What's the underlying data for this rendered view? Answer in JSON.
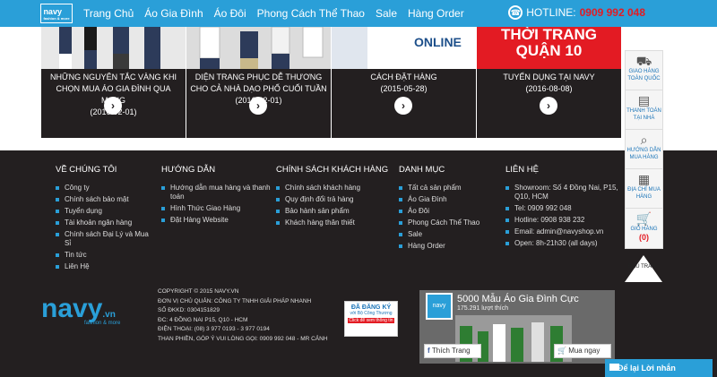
{
  "nav": {
    "logo_text": "navy",
    "logo_sub": "fashion & more",
    "menu": [
      "Trang Chủ",
      "Áo Gia Đình",
      "Áo Đôi",
      "Phong Cách Thể Thao",
      "Sale",
      "Hàng Order"
    ],
    "hotline_label": "HOTLINE:",
    "hotline_number": "0909 992 048"
  },
  "news": [
    {
      "title": "NHỮNG NGUYÊN TẮC VÀNG KHI CHỌN MUA ÁO GIA ĐÌNH QUA MẠNG",
      "date": "(2016-02-01)",
      "banner": ""
    },
    {
      "title": "DIỆN TRANG PHỤC DỄ THƯƠNG CHO CẢ NHÀ DẠO PHỐ CUỐI TUẦN",
      "date": "(2016-02-01)",
      "banner": ""
    },
    {
      "title": "CÁCH ĐẶT HÀNG",
      "date": "(2015-05-28)",
      "banner": "ONLINE"
    },
    {
      "title": "TUYỂN DỤNG TẠI NAVY",
      "date": "(2016-08-08)",
      "banner": "THỜI TRANG QUẬN 10"
    }
  ],
  "side": [
    {
      "label": "GIAO HÀNG TOÀN QUỐC",
      "icon": "truck-icon"
    },
    {
      "label": "THANH TOÁN TẠI NHÀ",
      "icon": "wallet-icon"
    },
    {
      "label": "HƯỚNG DẪN MUA HÀNG",
      "icon": "magnifier-icon"
    },
    {
      "label": "ĐỊA CHỈ MUA HÀNG",
      "icon": "store-icon"
    },
    {
      "label": "GIỎ HÀNG",
      "count": "(0)",
      "icon": "cart-icon"
    }
  ],
  "up_label": "ĐẦU TRANG",
  "footer": {
    "col1": {
      "head": "VỀ CHÚNG TÔI",
      "items": [
        "Công ty",
        "Chính sách bảo mật",
        "Tuyển dụng",
        "Tài khoản ngân hàng",
        "Chính sách Đại Lý và Mua Sỉ",
        "Tin tức",
        "Liên Hệ"
      ]
    },
    "col2": {
      "head": "HƯỚNG DẪN",
      "items": [
        "Hướng dẫn mua hàng và thanh toán",
        "Hình Thức Giao Hàng",
        "Đặt Hàng Website"
      ]
    },
    "col3": {
      "head": "CHÍNH SÁCH KHÁCH HÀNG",
      "items": [
        "Chính sách khách hàng",
        "Quy định đổi trả hàng",
        "Bảo hành sản phẩm",
        "Khách hàng thân thiết"
      ]
    },
    "col4": {
      "head": "DANH MỤC",
      "items": [
        "Tất cả sản phẩm",
        "Áo Gia Đình",
        "Áo Đôi",
        "Phong Cách Thể Thao",
        "Sale",
        "Hàng Order"
      ]
    },
    "col5": {
      "head": "LIÊN HỆ",
      "items": [
        "Showroom: Số 4 Đồng Nai, P15, Q10, HCM",
        "Tel: 0909 992 048",
        "Hotline: 0908 938 232",
        "Email: admin@navyshop.vn",
        "Open: 8h-21h30 (all days)"
      ]
    },
    "logo": "navy",
    "logo_suffix": ".vn",
    "logo_tag": "fashion & more",
    "copy": [
      "COPYRIGHT © 2015 NAVY.VN",
      "ĐƠN VỊ CHỦ QUẢN: CÔNG TY TNHH GIẢI PHÁP NHANH",
      "SỐ ĐKKD: 0304151829",
      "ĐC: 4 ĐỒNG NAI P15, Q10 - HCM",
      "ĐIỆN THOẠI: (08) 3 977 0193 - 3 977 0194",
      "THAN PHIỀN, GÓP Ý VUI LÒNG GỌI: 0909 992 048 - MR CẢNH"
    ],
    "badge": {
      "t1": "ĐÃ ĐĂNG KÝ",
      "t2": "với Bộ Công Thương",
      "t3": "Click để xem thông tin"
    },
    "fb": {
      "avatar": "navy",
      "name": "5000 Mẫu Áo Gia Đình Cực",
      "likes": "175.291 lượt thích",
      "like_btn": "Thích Trang",
      "buy_btn": "Mua ngay"
    }
  },
  "chat": "Để lại Lời nhắn"
}
